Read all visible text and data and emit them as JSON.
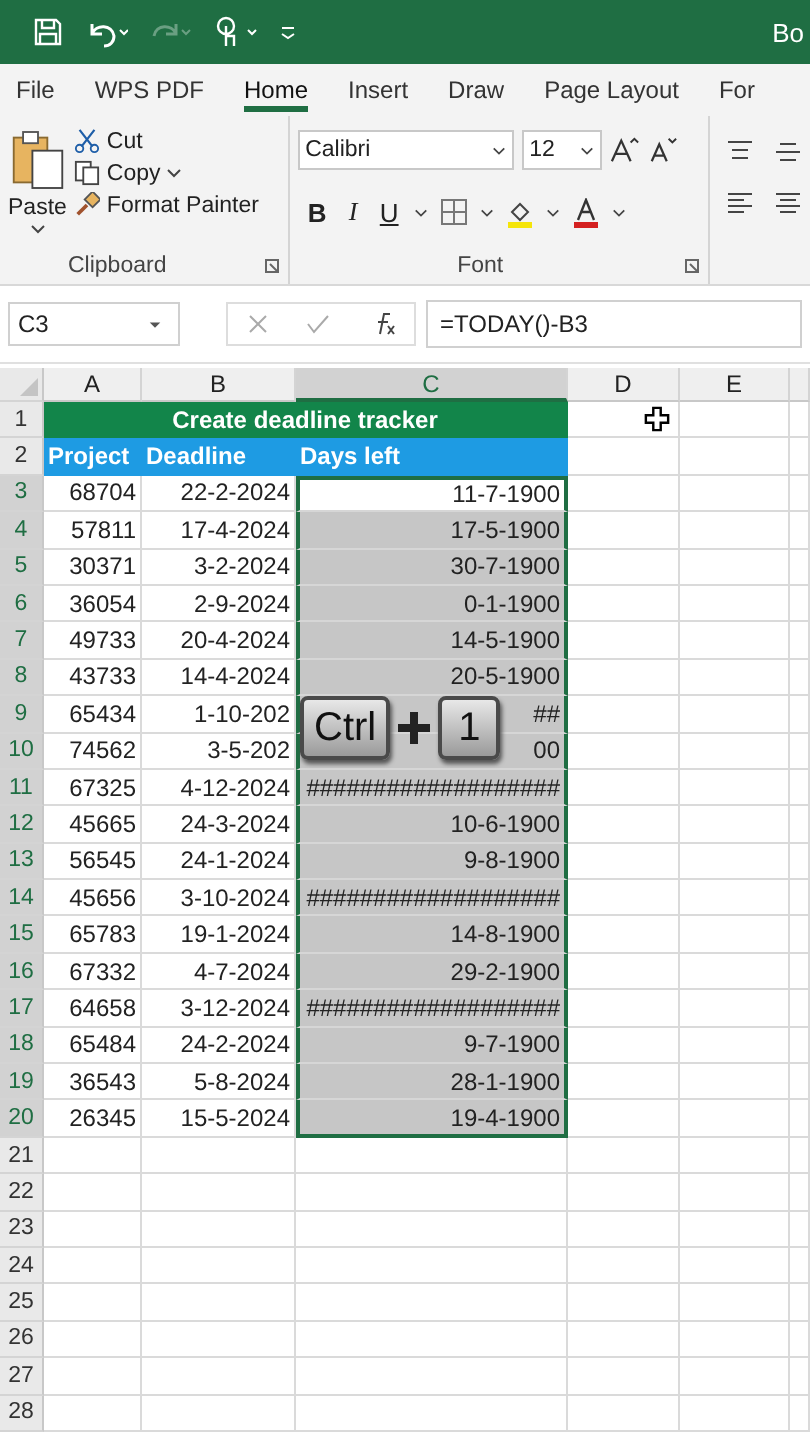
{
  "title_bar": {
    "title": "Bo"
  },
  "ribbon_tabs": [
    {
      "label": "File",
      "selected": false
    },
    {
      "label": "WPS PDF",
      "selected": false
    },
    {
      "label": "Home",
      "selected": true
    },
    {
      "label": "Insert",
      "selected": false
    },
    {
      "label": "Draw",
      "selected": false
    },
    {
      "label": "Page Layout",
      "selected": false
    },
    {
      "label": "For",
      "selected": false
    }
  ],
  "clipboard": {
    "paste": "Paste",
    "cut": "Cut",
    "copy": "Copy",
    "format_painter": "Format Painter",
    "label": "Clipboard"
  },
  "font": {
    "family": "Calibri",
    "size": "12",
    "bold": "B",
    "italic": "I",
    "underline": "U",
    "label": "Font"
  },
  "formula_bar": {
    "name_box": "C3",
    "formula": "=TODAY()-B3"
  },
  "columns": [
    {
      "label": "A",
      "selected": false
    },
    {
      "label": "B",
      "selected": false
    },
    {
      "label": "C",
      "selected": true
    },
    {
      "label": "D",
      "selected": false
    },
    {
      "label": "E",
      "selected": false
    }
  ],
  "sheet": {
    "title_row": "1",
    "title": "Create deadline tracker",
    "header_row": "2",
    "headers": [
      "Project",
      "Deadline",
      "Days left"
    ],
    "rows": [
      {
        "num": "3",
        "project": "68704",
        "deadline": "22-2-2024",
        "days_left": "11-7-1900",
        "selected": true,
        "active": true
      },
      {
        "num": "4",
        "project": "57811",
        "deadline": "17-4-2024",
        "days_left": "17-5-1900",
        "selected": true,
        "active": false
      },
      {
        "num": "5",
        "project": "30371",
        "deadline": "3-2-2024",
        "days_left": "30-7-1900",
        "selected": true,
        "active": false
      },
      {
        "num": "6",
        "project": "36054",
        "deadline": "2-9-2024",
        "days_left": "0-1-1900",
        "selected": true,
        "active": false
      },
      {
        "num": "7",
        "project": "49733",
        "deadline": "20-4-2024",
        "days_left": "14-5-1900",
        "selected": true,
        "active": false
      },
      {
        "num": "8",
        "project": "43733",
        "deadline": "14-4-2024",
        "days_left": "20-5-1900",
        "selected": true,
        "active": false
      },
      {
        "num": "9",
        "project": "65434",
        "deadline": "1-10-202",
        "days_left": "##",
        "selected": true,
        "active": false
      },
      {
        "num": "10",
        "project": "74562",
        "deadline": "3-5-202",
        "days_left": "00",
        "selected": true,
        "active": false
      },
      {
        "num": "11",
        "project": "67325",
        "deadline": "4-12-2024",
        "days_left": "###################",
        "selected": true,
        "active": false
      },
      {
        "num": "12",
        "project": "45665",
        "deadline": "24-3-2024",
        "days_left": "10-6-1900",
        "selected": true,
        "active": false
      },
      {
        "num": "13",
        "project": "56545",
        "deadline": "24-1-2024",
        "days_left": "9-8-1900",
        "selected": true,
        "active": false
      },
      {
        "num": "14",
        "project": "45656",
        "deadline": "3-10-2024",
        "days_left": "###################",
        "selected": true,
        "active": false
      },
      {
        "num": "15",
        "project": "65783",
        "deadline": "19-1-2024",
        "days_left": "14-8-1900",
        "selected": true,
        "active": false
      },
      {
        "num": "16",
        "project": "67332",
        "deadline": "4-7-2024",
        "days_left": "29-2-1900",
        "selected": true,
        "active": false
      },
      {
        "num": "17",
        "project": "64658",
        "deadline": "3-12-2024",
        "days_left": "###################",
        "selected": true,
        "active": false
      },
      {
        "num": "18",
        "project": "65484",
        "deadline": "24-2-2024",
        "days_left": "9-7-1900",
        "selected": true,
        "active": false
      },
      {
        "num": "19",
        "project": "36543",
        "deadline": "5-8-2024",
        "days_left": "28-1-1900",
        "selected": true,
        "active": false
      },
      {
        "num": "20",
        "project": "26345",
        "deadline": "15-5-2024",
        "days_left": "19-4-1900",
        "selected": true,
        "active": false
      }
    ],
    "empty_rows": [
      "21",
      "22",
      "23",
      "24",
      "25",
      "26",
      "27",
      "28"
    ]
  },
  "key_overlay": {
    "keys": [
      "Ctrl",
      "1"
    ]
  }
}
